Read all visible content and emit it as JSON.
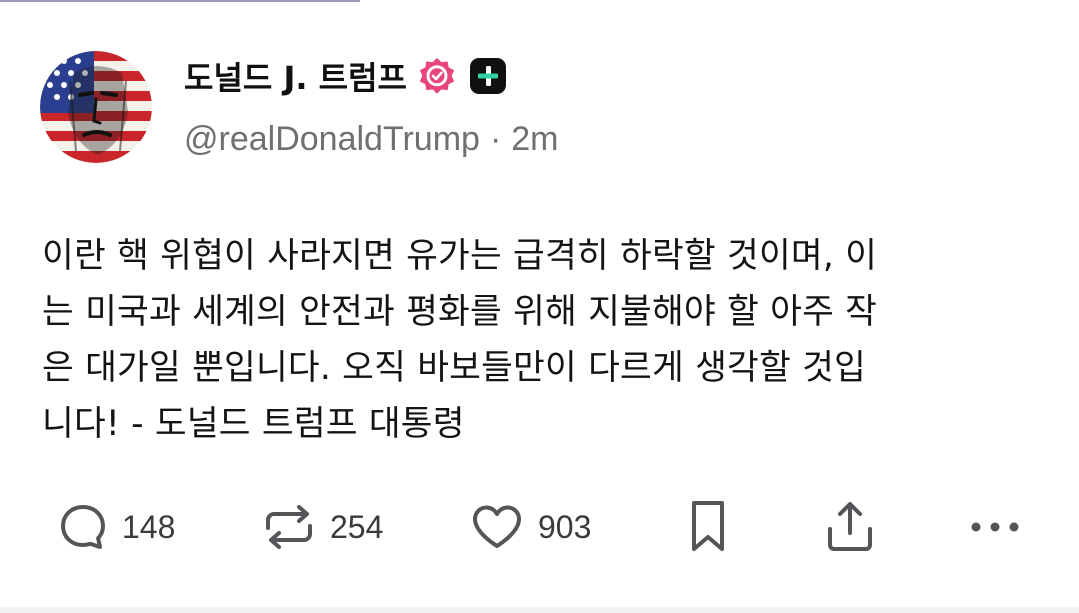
{
  "post": {
    "author_name": "도널드 J. 트럼프",
    "handle": "@realDonaldTrump",
    "separator": "·",
    "time": "2m",
    "body_lines": [
      "이란 핵 위협이 사라지면 유가는 급격히 하락할 것이며, 이",
      "는 미국과 세계의 안전과 평화를 위해 지불해야 할 아주 작",
      "은 대가일 뿐입니다. 오직 바보들만이 다르게 생각할 것입",
      "니다! - 도널드 트럼프 대통령"
    ]
  },
  "actions": {
    "reply_count": "148",
    "repost_count": "254",
    "like_count": "903"
  },
  "icons": {
    "verified": "verified-badge-icon",
    "plus": "plus-badge-icon",
    "reply": "comment-bubble-icon",
    "repost": "repost-arrows-icon",
    "like": "heart-icon",
    "bookmark": "bookmark-icon",
    "share": "share-upload-icon",
    "more": "more-dots-icon"
  },
  "colors": {
    "verified_badge": "#e8457a",
    "plus_badge": "#111111",
    "plus_sign": "#35d0a6",
    "handle_text": "#6f6f74",
    "icon_gray": "#555559"
  }
}
